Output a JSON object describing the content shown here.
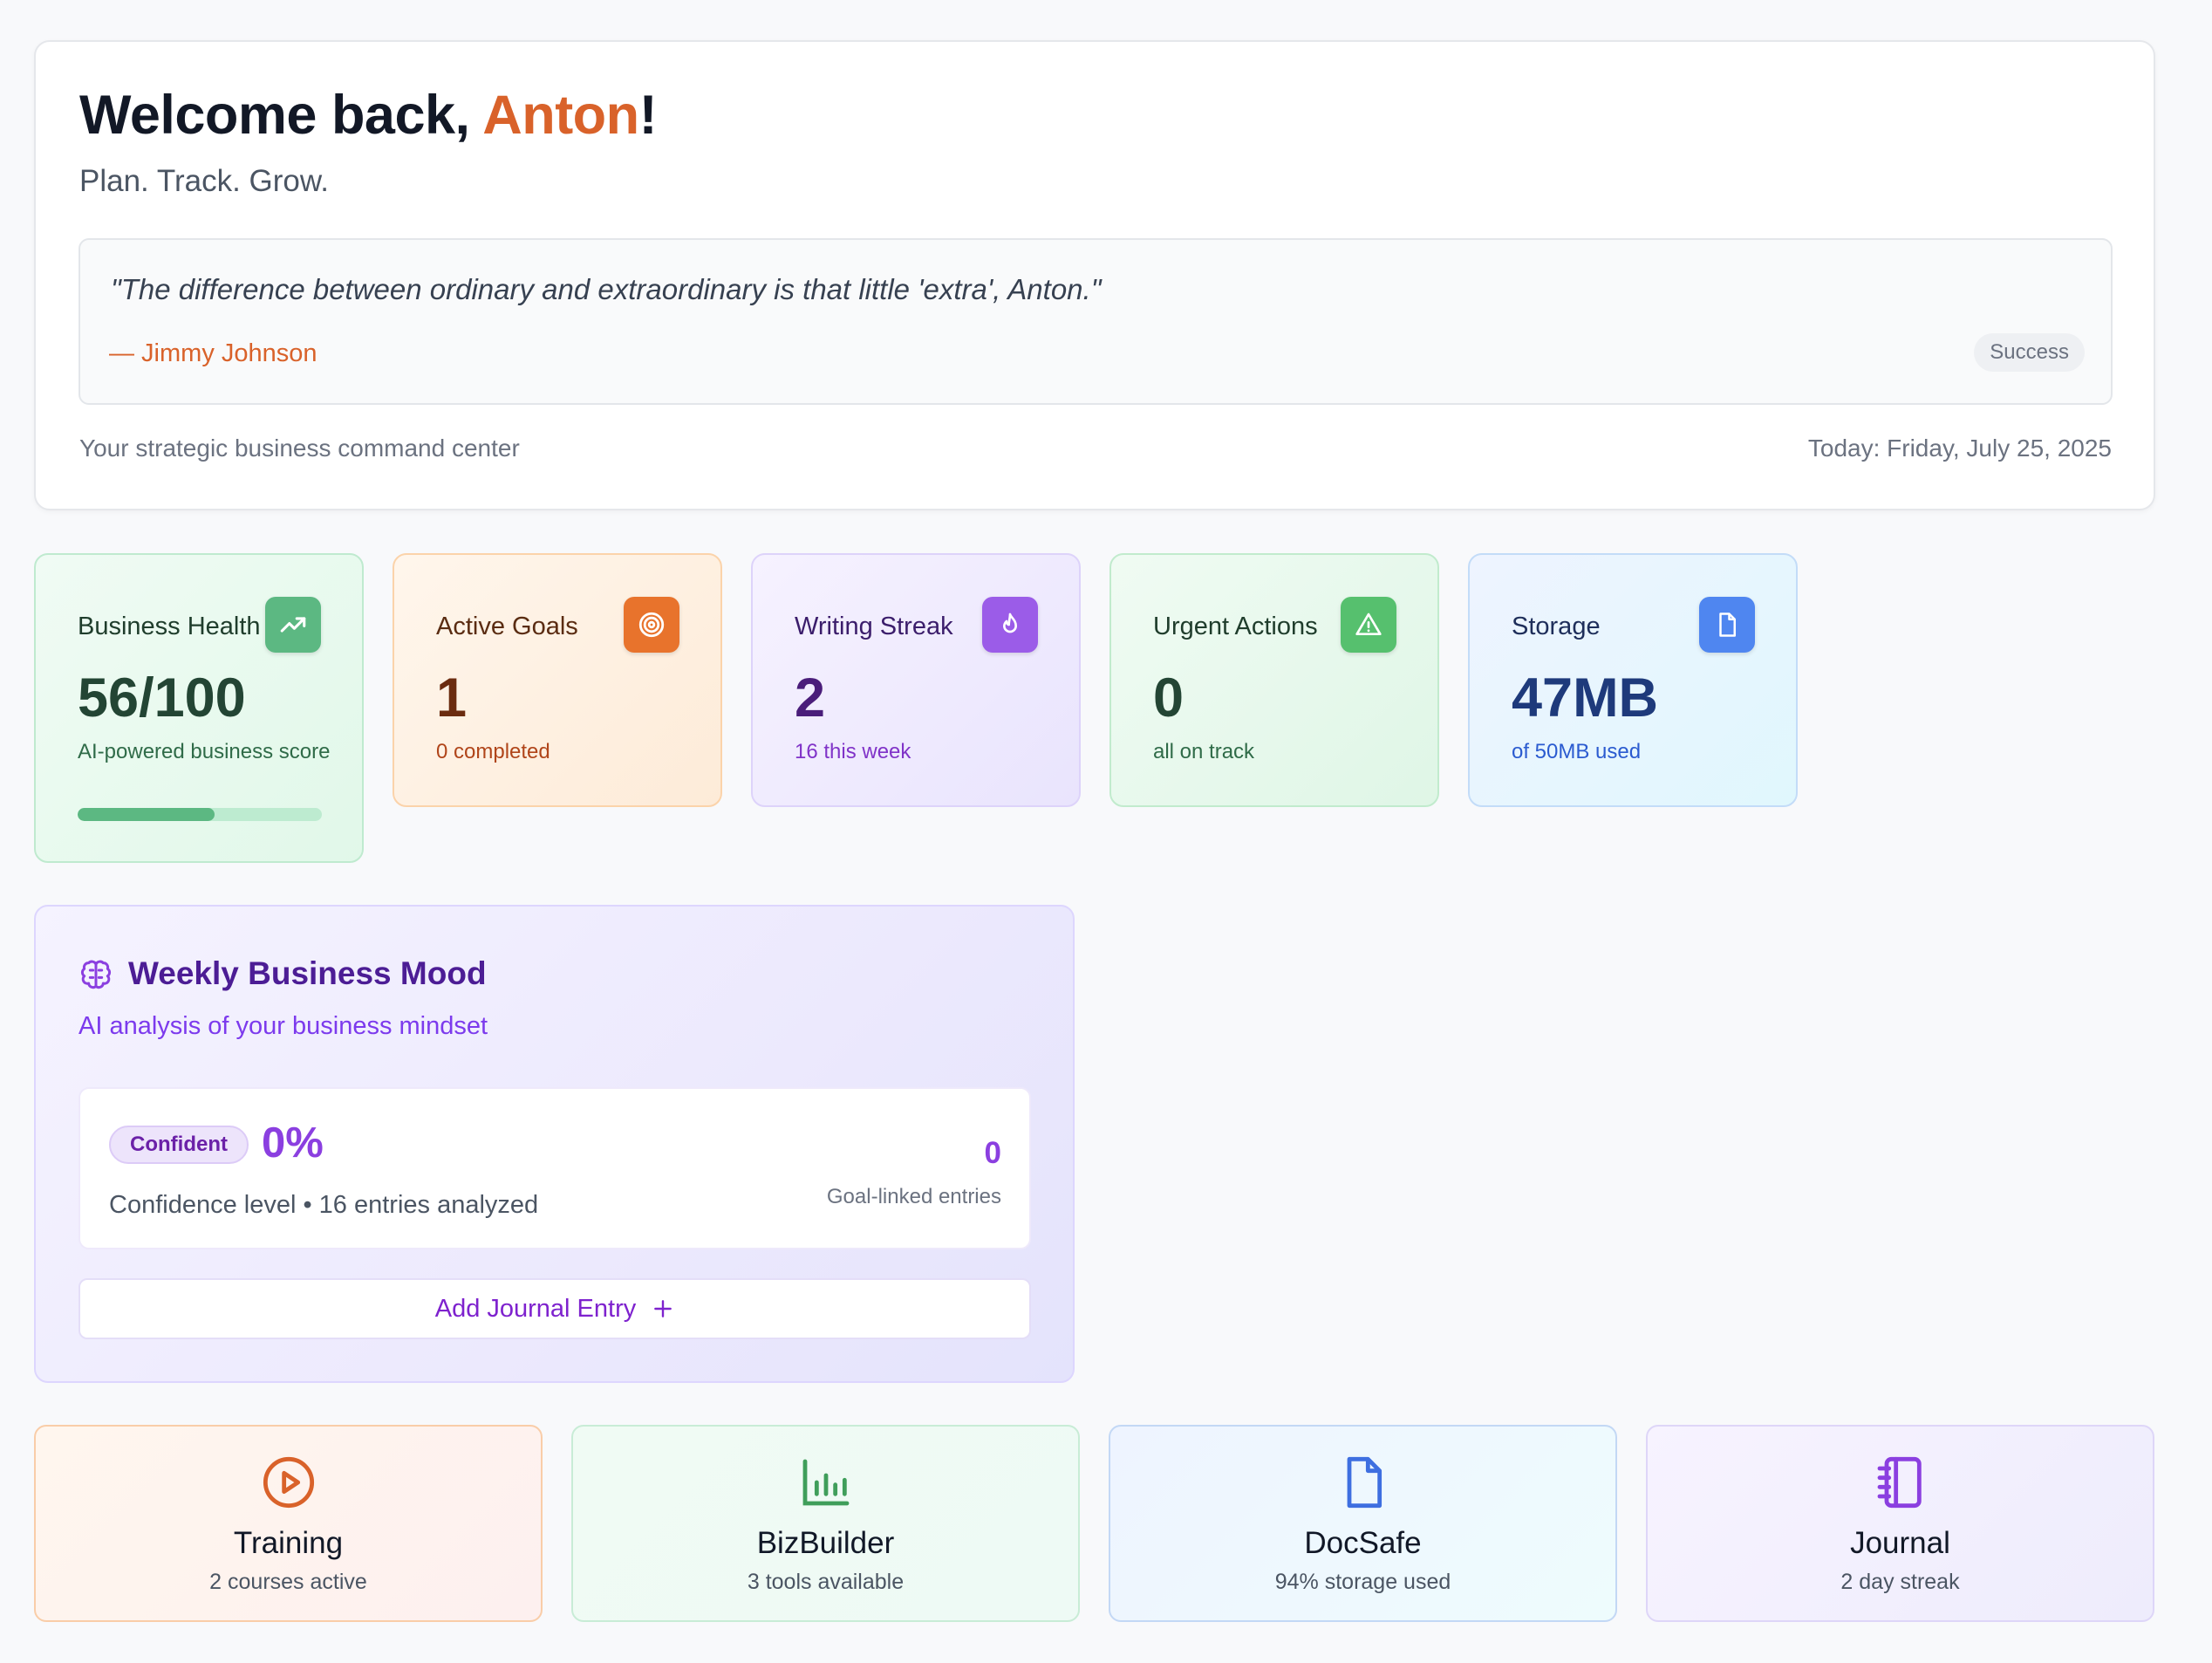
{
  "welcome": {
    "greeting": "Welcome back, ",
    "name": "Anton",
    "exclamation": "!",
    "subtitle": "Plan. Track. Grow.",
    "quote": {
      "text": "\"The difference between ordinary and extraordinary is that little 'extra', Anton.\"",
      "author": "— Jimmy Johnson",
      "tag": "Success"
    },
    "footer_left": "Your strategic business command center",
    "footer_right": "Today: Friday, July 25, 2025"
  },
  "stats": [
    {
      "label": "Business Health",
      "value": "56/100",
      "sub": "AI-powered business score",
      "icon": "trending-up-icon",
      "progress": 0.56
    },
    {
      "label": "Active Goals",
      "value": "1",
      "sub": "0 completed",
      "icon": "target-icon"
    },
    {
      "label": "Writing Streak",
      "value": "2",
      "sub": "16 this week",
      "icon": "flame-icon"
    },
    {
      "label": "Urgent Actions",
      "value": "0",
      "sub": "all on track",
      "icon": "alert-triangle-icon"
    },
    {
      "label": "Storage",
      "value": "47MB",
      "sub": "of 50MB used",
      "icon": "file-icon"
    }
  ],
  "mood": {
    "icon": "brain-icon",
    "title": "Weekly Business Mood",
    "subtitle": "AI analysis of your business mindset",
    "badge": "Confident",
    "percent": "0%",
    "confidence_text": "Confidence level • 16 entries analyzed",
    "goal_count": "0",
    "goal_label": "Goal-linked entries",
    "add_button": "Add Journal Entry",
    "add_icon": "plus-icon"
  },
  "apps": [
    {
      "title": "Training",
      "sub": "2 courses active",
      "icon": "play-circle-icon"
    },
    {
      "title": "BizBuilder",
      "sub": "3 tools available",
      "icon": "bar-chart-icon"
    },
    {
      "title": "DocSafe",
      "sub": "94% storage used",
      "icon": "document-icon"
    },
    {
      "title": "Journal",
      "sub": "2 day streak",
      "icon": "notebook-icon"
    }
  ],
  "colors": {
    "accent": "#d9622a",
    "health": "#5cb882",
    "goals": "#e8732c",
    "streak": "#9b5ce8",
    "urgent": "#56c06e",
    "storage": "#4f86f0",
    "mood": "#7c3aed"
  }
}
